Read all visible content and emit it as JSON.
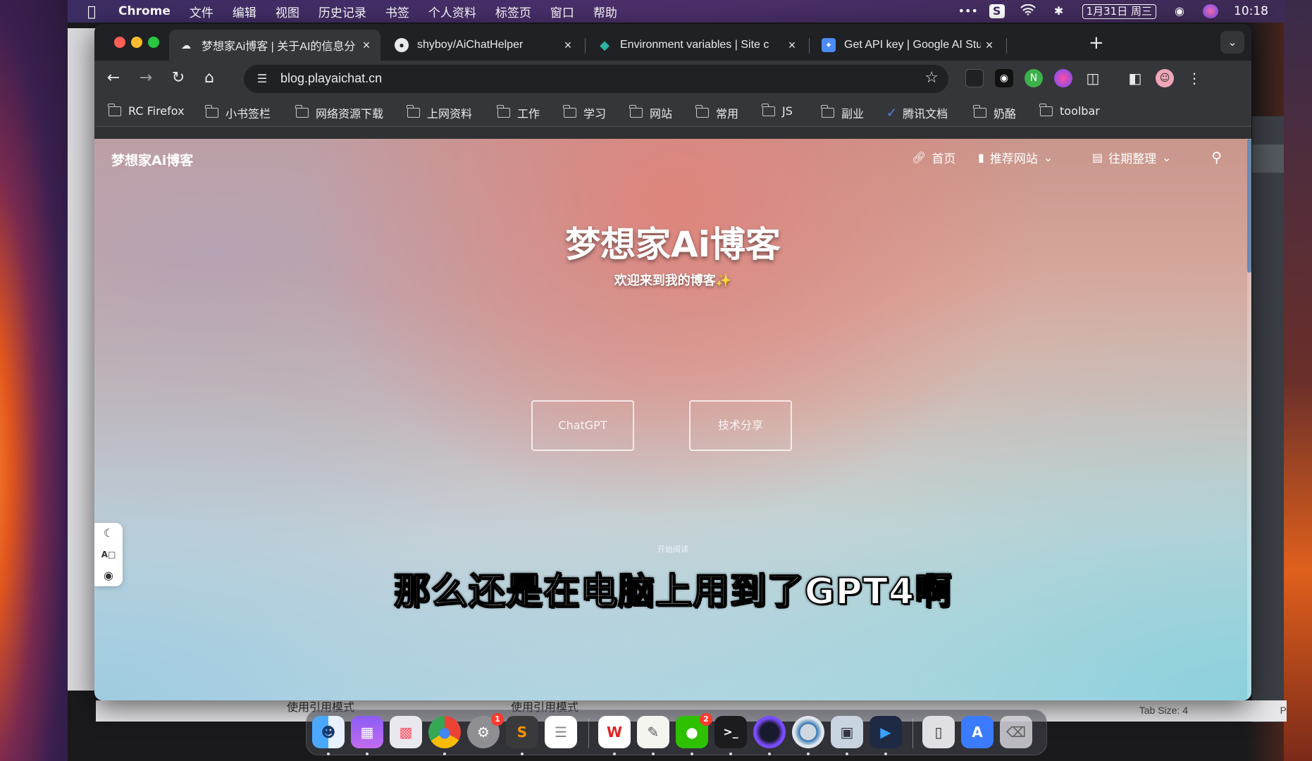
{
  "menubar": {
    "app_name": "Chrome",
    "items": [
      "文件",
      "编辑",
      "视图",
      "历史记录",
      "书签",
      "个人资料",
      "标签页",
      "窗口",
      "帮助"
    ],
    "date": "1月31日 周三",
    "time": "10:18"
  },
  "tabs": [
    {
      "title": "梦想家Ai博客 | 关于AI的信息分",
      "close": "×",
      "active": true
    },
    {
      "title": "shyboy/AiChatHelper",
      "close": "×",
      "active": false
    },
    {
      "title": "Environment variables | Site c",
      "close": "×",
      "active": false
    },
    {
      "title": "Get API key | Google AI Studio",
      "close": "×",
      "active": false
    }
  ],
  "new_tab": "+",
  "address_bar": {
    "url": "blog.playaichat.cn"
  },
  "bookmarks": [
    "RC Firefox",
    "小书签栏",
    "网络资源下载",
    "上网资料",
    "工作",
    "学习",
    "网站",
    "常用",
    "JS",
    "副业",
    "腾讯文档",
    "奶酪",
    "toolbar"
  ],
  "site": {
    "logo": "梦想家Ai博客",
    "nav": [
      {
        "label": "首页",
        "icon": "link-icon"
      },
      {
        "label": "推荐网站",
        "icon": "folder-icon"
      },
      {
        "label": "往期整理",
        "icon": "archive-icon"
      }
    ],
    "hero_title": "梦想家Ai博客",
    "hero_subtitle": "欢迎来到我的博客✨",
    "buttons": [
      "ChatGPT",
      "技术分享"
    ],
    "scroll_hint": "开始阅读"
  },
  "video_subtitle": "那么还是在电脑上用到了GPT4啊",
  "background_editor": {
    "status_tab_size": "Tab Size: 4",
    "status_extra": "P",
    "tab_labels": [
      "使用引用模式",
      "使用引用模式"
    ]
  },
  "dock": {
    "items": [
      "finder",
      "notes",
      "launchpad",
      "chrome",
      "settings",
      "sublime",
      "reminders",
      "wps",
      "textedit",
      "wechat",
      "terminal",
      "obs",
      "quicktime",
      "preview",
      "video",
      "phone",
      "appstore",
      "trash"
    ],
    "badges": {
      "settings": "1",
      "wechat": "2"
    }
  },
  "colors": {
    "accent": "#6a8ab0",
    "tab_bar": "#202124",
    "toolbar": "#35363a"
  }
}
